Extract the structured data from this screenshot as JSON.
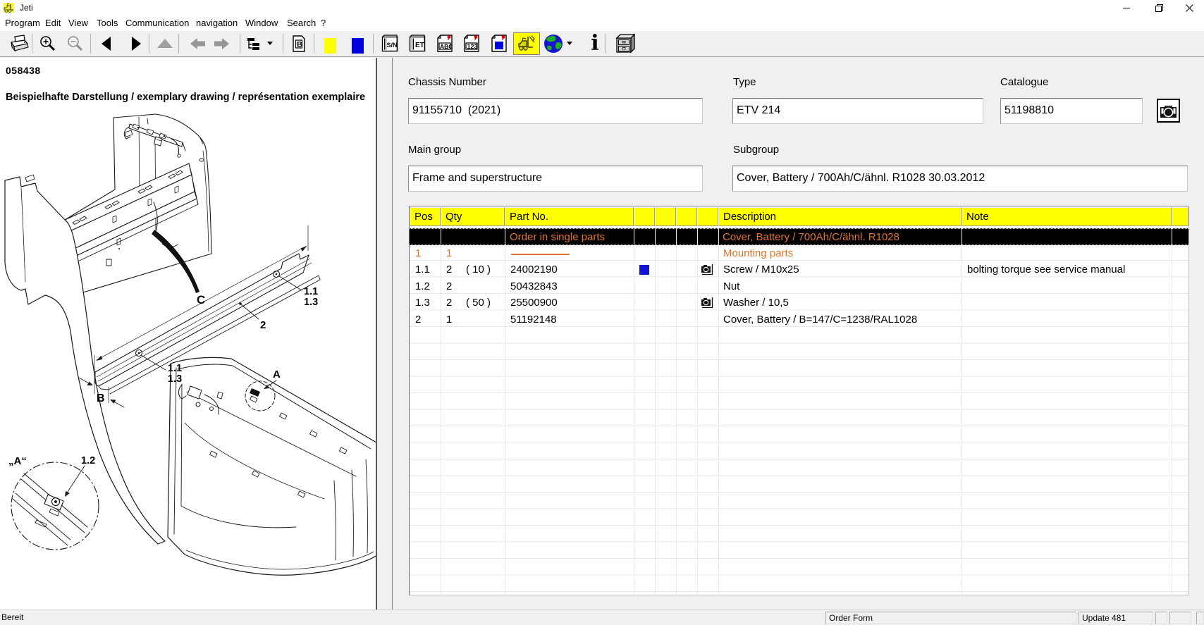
{
  "window": {
    "title": "Jeti",
    "controls": {
      "minimize": "minimize",
      "restore": "restore",
      "close": "close"
    }
  },
  "menu": {
    "items": [
      "Program",
      "Edit",
      "View",
      "Tools",
      "Communication",
      "navigation",
      "Window",
      "Search",
      "?"
    ]
  },
  "toolbar": {
    "b_doc_label": "B",
    "sn_book_label": "S/N",
    "et_book_label": "ET",
    "abc_doc_label": "ABC",
    "num_doc_label": "123"
  },
  "drawing": {
    "number": "058438",
    "caption": "Beispielhafte Darstellung / exemplary drawing / représentation exemplaire",
    "labels": {
      "c": "C",
      "two": "2",
      "pos11": "1.1",
      "pos13": "1.3",
      "b": "B",
      "a": "A",
      "a_detail": "„A“",
      "pos12": "1.2"
    }
  },
  "form": {
    "chassis_label": "Chassis Number",
    "chassis_value": "91155710  (2021)",
    "type_label": "Type",
    "type_value": "ETV 214",
    "catalogue_label": "Catalogue",
    "catalogue_value": "51198810",
    "main_group_label": "Main group",
    "main_group_value": "Frame and superstructure",
    "subgroup_label": "Subgroup",
    "subgroup_value": "Cover, Battery / 700Ah/C/ähnl. R1028 30.03.2012"
  },
  "table": {
    "headers": {
      "pos": "Pos",
      "qty": "Qty",
      "part": "Part No.",
      "description": "Description",
      "note": "Note"
    },
    "rows": [
      {
        "pos": "",
        "qty": "",
        "paren": "",
        "part": "Order in single parts",
        "description": "Cover, Battery / 700Ah/C/ähnl. R1028",
        "note": ""
      },
      {
        "pos": "1",
        "qty": "1",
        "paren": "",
        "part": "",
        "description": "Mounting parts",
        "note": ""
      },
      {
        "pos": "1.1",
        "qty": "2",
        "paren": "( 10 )",
        "part": "24002190",
        "description": "Screw / M10x25",
        "note": "bolting torque see service manual"
      },
      {
        "pos": "1.2",
        "qty": "2",
        "paren": "",
        "part": "50432843",
        "description": "Nut",
        "note": ""
      },
      {
        "pos": "1.3",
        "qty": "2",
        "paren": "( 50 )",
        "part": "25500900",
        "description": "Washer / 10,5",
        "note": ""
      },
      {
        "pos": "2",
        "qty": "1",
        "paren": "",
        "part": "51192148",
        "description": "Cover, Battery / B=147/C=1238/RAL1028",
        "note": ""
      }
    ]
  },
  "statusbar": {
    "ready": "Bereit",
    "order_form": "Order Form",
    "update": "Update 481"
  },
  "colors": {
    "accent_orange": "#e3742c",
    "header_yellow": "#ffff00",
    "selection_black": "#000000",
    "marker_blue": "#1313d2"
  }
}
